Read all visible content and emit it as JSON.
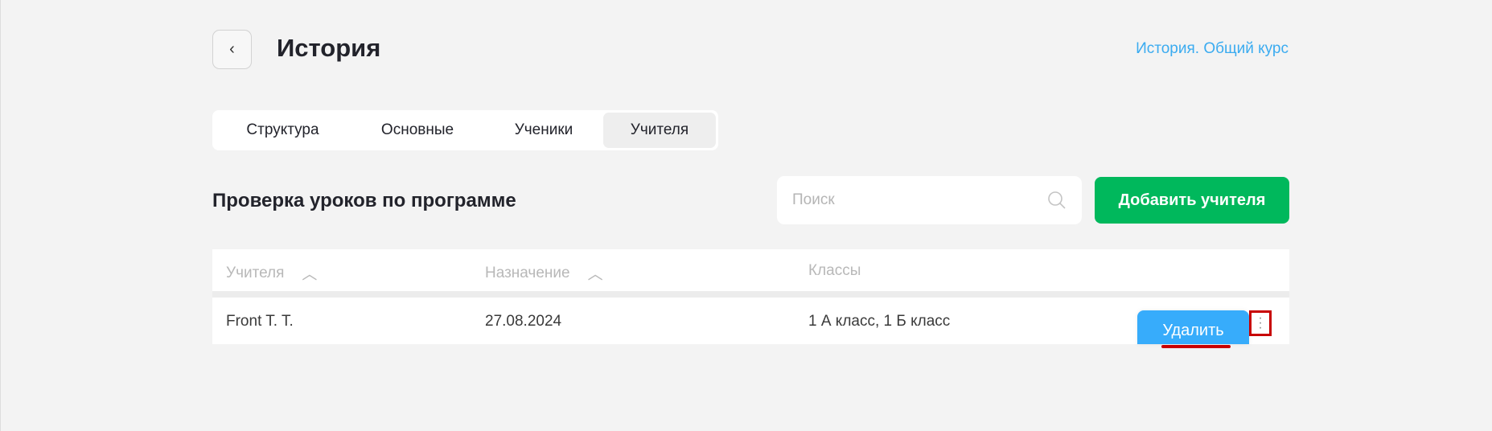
{
  "header": {
    "back_icon": "chevron-left-icon",
    "title": "История",
    "course_link": "История. Общий курс"
  },
  "tabs": [
    {
      "label": "Структура"
    },
    {
      "label": "Основные"
    },
    {
      "label": "Ученики"
    },
    {
      "label": "Учителя",
      "active": true
    }
  ],
  "section": {
    "title": "Проверка уроков по программе",
    "search_placeholder": "Поиск",
    "add_button": "Добавить учителя"
  },
  "table": {
    "columns": [
      "Учителя",
      "Назначение",
      "Классы"
    ],
    "rows": [
      {
        "teacher": "Front T. T.",
        "date": "27.08.2024",
        "classes": "1 А класс, 1 Б класс"
      }
    ]
  },
  "row_menu": {
    "delete": "Удалить"
  },
  "colors": {
    "accent": "#3aabf0",
    "add": "#00b85c",
    "delete": "#37acfb",
    "highlight": "#c80000"
  }
}
